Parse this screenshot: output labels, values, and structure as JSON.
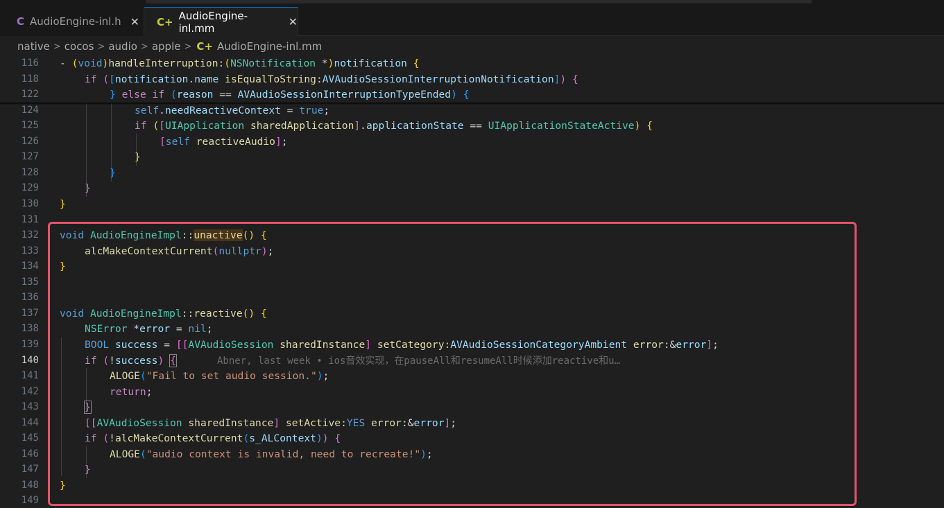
{
  "tabs": [
    {
      "icon": "C",
      "label": "AudioEngine-inl.h",
      "close": "✕",
      "active": false
    },
    {
      "icon": "C+",
      "label": "AudioEngine-inl.mm",
      "close": "✕",
      "active": true
    }
  ],
  "breadcrumb": {
    "parts": [
      "native",
      "cocos",
      "audio",
      "apple"
    ],
    "file_icon": "C+",
    "file": "AudioEngine-inl.mm",
    "separator": ">"
  },
  "sticky_lines": [
    {
      "num": "116",
      "text": "- (void)handleInterruption:(NSNotification *)notification {"
    },
    {
      "num": "118",
      "text": "if ([notification.name isEqualToString:AVAudioSessionInterruptionNotification]) {"
    },
    {
      "num": "122",
      "text": "} else if (reason == AVAudioSessionInterruptionTypeEnded) {"
    }
  ],
  "lines": [
    {
      "num": "124",
      "text": "self.needReactiveContext = true;"
    },
    {
      "num": "125",
      "text": "if ([UIApplication sharedApplication].applicationState == UIApplicationStateActive) {"
    },
    {
      "num": "126",
      "text": "[self reactiveAudio];"
    },
    {
      "num": "127",
      "text": "}"
    },
    {
      "num": "128",
      "text": "}"
    },
    {
      "num": "129",
      "text": "}"
    },
    {
      "num": "130",
      "text": "}"
    },
    {
      "num": "131",
      "text": ""
    },
    {
      "num": "132",
      "text": "void AudioEngineImpl::unactive() {"
    },
    {
      "num": "133",
      "text": "alcMakeContextCurrent(nullptr);"
    },
    {
      "num": "134",
      "text": "}"
    },
    {
      "num": "135",
      "text": ""
    },
    {
      "num": "136",
      "text": ""
    },
    {
      "num": "137",
      "text": "void AudioEngineImpl::reactive() {"
    },
    {
      "num": "138",
      "text": "NSError *error = nil;"
    },
    {
      "num": "139",
      "text": "BOOL success = [[AVAudioSession sharedInstance] setCategory:AVAudioSessionCategoryAmbient error:&error];"
    },
    {
      "num": "140",
      "text": "if (!success) {"
    },
    {
      "num": "141",
      "text": "ALOGE(\"Fail to set audio session.\");"
    },
    {
      "num": "142",
      "text": "return;"
    },
    {
      "num": "143",
      "text": "}"
    },
    {
      "num": "144",
      "text": "[[AVAudioSession sharedInstance] setActive:YES error:&error];"
    },
    {
      "num": "145",
      "text": "if (!alcMakeContextCurrent(s_ALContext)) {"
    },
    {
      "num": "146",
      "text": "ALOGE(\"audio context is invalid, need to recreate!\");"
    },
    {
      "num": "147",
      "text": "}"
    },
    {
      "num": "148",
      "text": "}"
    },
    {
      "num": "149",
      "text": ""
    }
  ],
  "blame_hint": "Abner, last week • ios音效实现，在pauseAll和resumeAll时候添加reactive和u…",
  "current_line": "140",
  "colors": {
    "highlight_border": "#e2556a",
    "background": "#1f1f1f",
    "accent": "#0078d4"
  }
}
